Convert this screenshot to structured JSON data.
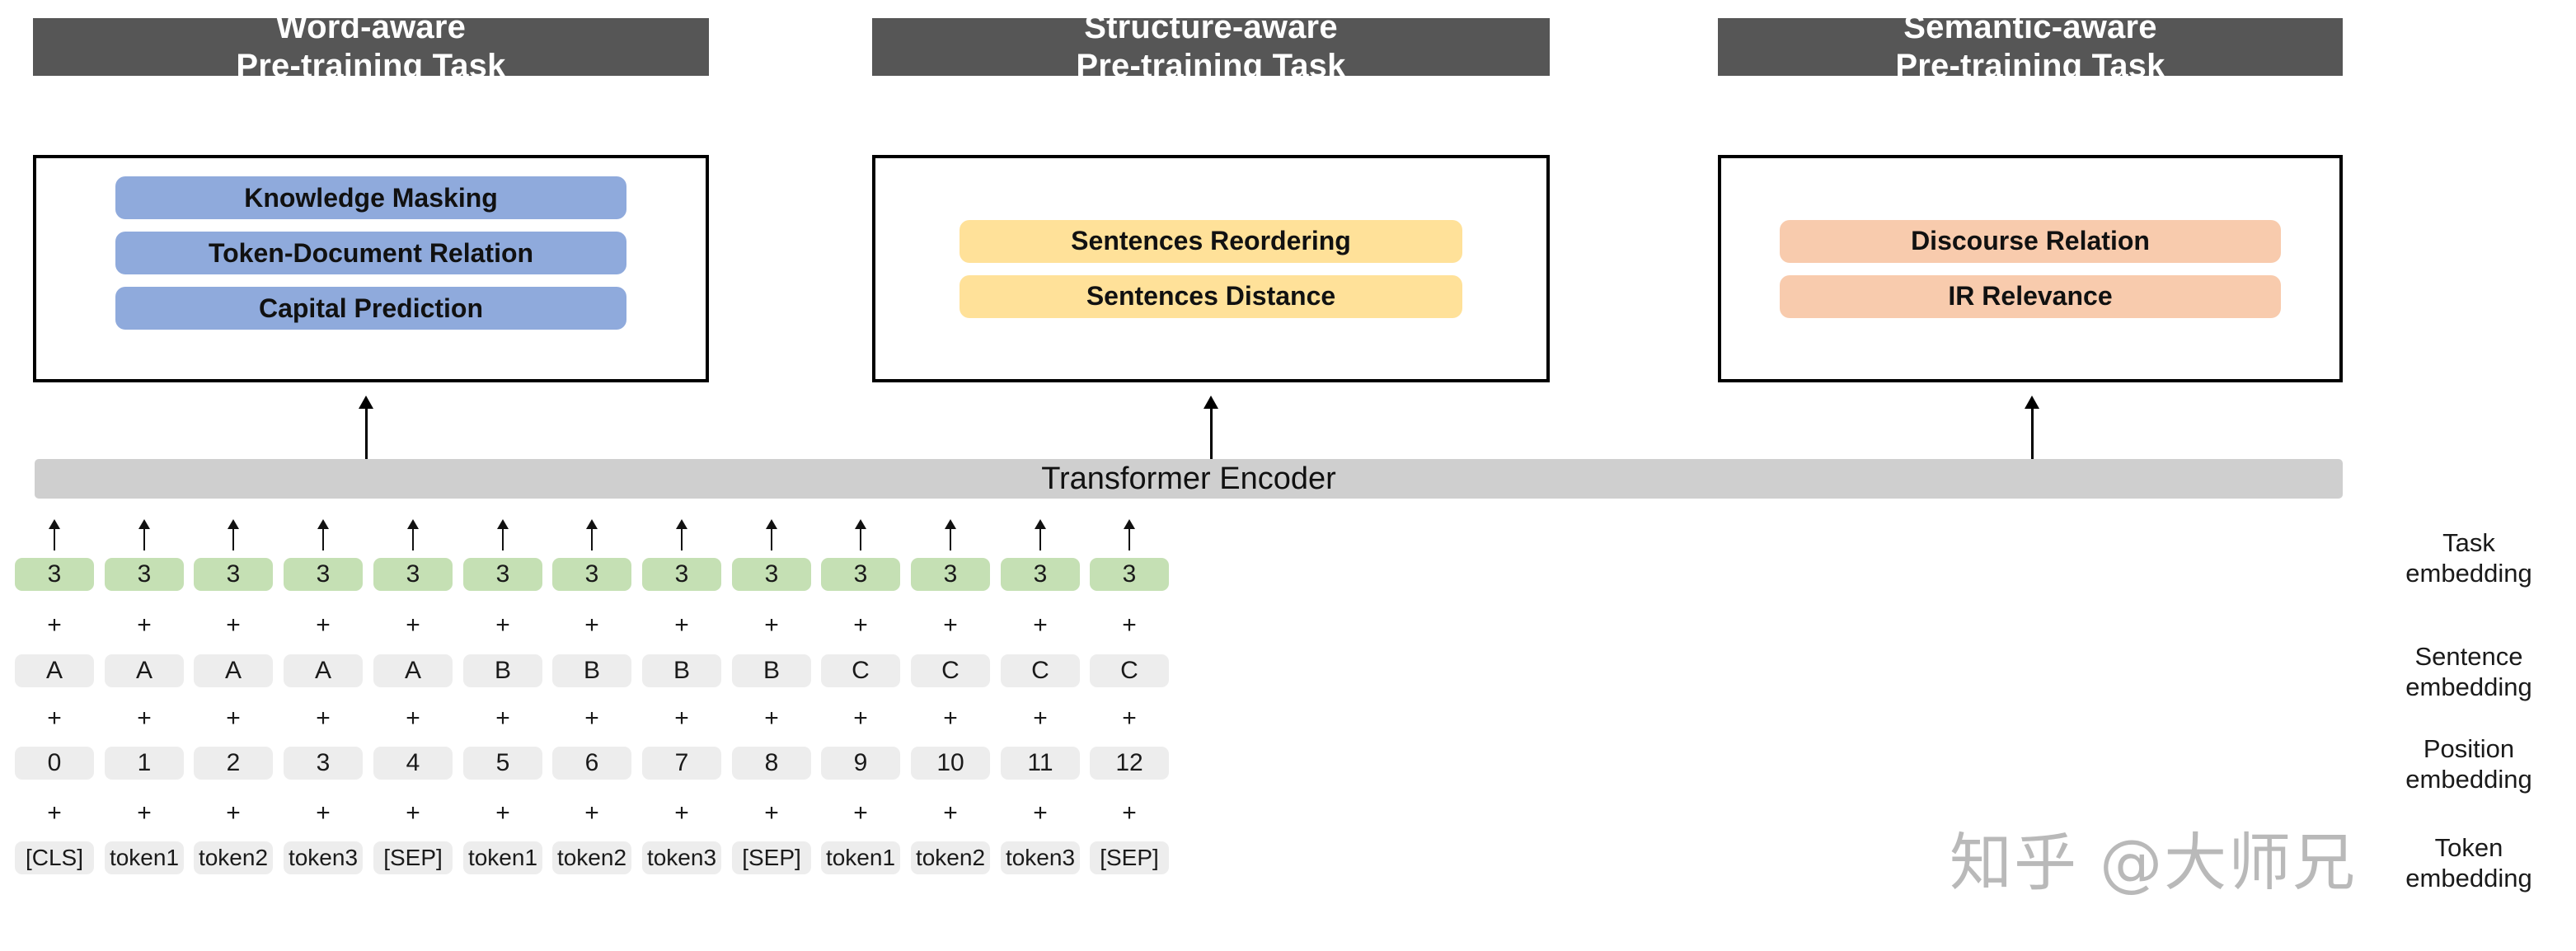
{
  "groups": [
    {
      "title_line1": "Word-aware",
      "title_line2": "Pre-training Task",
      "pill_color": "#8faadc",
      "tasks": [
        "Knowledge Masking",
        "Token-Document Relation",
        "Capital Prediction"
      ]
    },
    {
      "title_line1": "Structure-aware",
      "title_line2": "Pre-training Task",
      "pill_color": "#ffe199",
      "tasks": [
        "Sentences Reordering",
        "Sentences Distance"
      ]
    },
    {
      "title_line1": "Semantic-aware",
      "title_line2": "Pre-training Task",
      "pill_color": "#f8cbad",
      "tasks": [
        "Discourse Relation",
        "IR Relevance"
      ]
    }
  ],
  "encoder": {
    "label": "Transformer Encoder",
    "fill_color": "#cfcfcf"
  },
  "embeddings": {
    "plus_symbol": "+",
    "rows": [
      {
        "name": "task",
        "label_line1": "Task",
        "label_line2": "embedding",
        "fill_color": "#c5e0b4",
        "values": [
          "3",
          "3",
          "3",
          "3",
          "3",
          "3",
          "3",
          "3",
          "3",
          "3",
          "3",
          "3",
          "3"
        ]
      },
      {
        "name": "sentence",
        "label_line1": "Sentence",
        "label_line2": "embedding",
        "fill_color": "#ededed",
        "values": [
          "A",
          "A",
          "A",
          "A",
          "A",
          "B",
          "B",
          "B",
          "B",
          "C",
          "C",
          "C",
          "C"
        ]
      },
      {
        "name": "position",
        "label_line1": "Position",
        "label_line2": "embedding",
        "fill_color": "#ededed",
        "values": [
          "0",
          "1",
          "2",
          "3",
          "4",
          "5",
          "6",
          "7",
          "8",
          "9",
          "10",
          "11",
          "12"
        ]
      },
      {
        "name": "token",
        "label_line1": "Token",
        "label_line2": "embedding",
        "fill_color": "#ededed",
        "values": [
          "[CLS]",
          "token1",
          "token2",
          "token3",
          "[SEP]",
          "token1",
          "token2",
          "token3",
          "[SEP]",
          "token1",
          "token2",
          "token3",
          "[SEP]"
        ]
      }
    ]
  },
  "watermark": {
    "text": "知乎 @大师兄",
    "color": "#b9b9b9"
  }
}
